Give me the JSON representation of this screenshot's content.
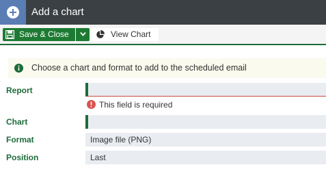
{
  "window": {
    "title": "Add a chart",
    "header_icon": "plus-circle-icon"
  },
  "toolbar": {
    "save_close_label": "Save & Close",
    "view_chart_label": "View Chart",
    "icons": {
      "save": "floppy-disk-icon",
      "dropdown": "chevron-down-icon",
      "view_chart": "pie-chart-icon"
    }
  },
  "info": {
    "message": "Choose a chart and format to add to the scheduled email",
    "icon": "info-icon"
  },
  "form": {
    "report": {
      "label": "Report",
      "value": "",
      "error": "This field is required"
    },
    "chart": {
      "label": "Chart",
      "value": ""
    },
    "format": {
      "label": "Format",
      "value": "Image file (PNG)"
    },
    "position": {
      "label": "Position",
      "value": "Last"
    }
  },
  "colors": {
    "titlebar": "#3b4044",
    "title_icon_bg": "#5a7db3",
    "primary_green": "#1d7a33",
    "label_green": "#1d6b3a",
    "error_red": "#d9534f",
    "field_bg": "#e9edf1",
    "info_bg": "#fbfaee"
  }
}
